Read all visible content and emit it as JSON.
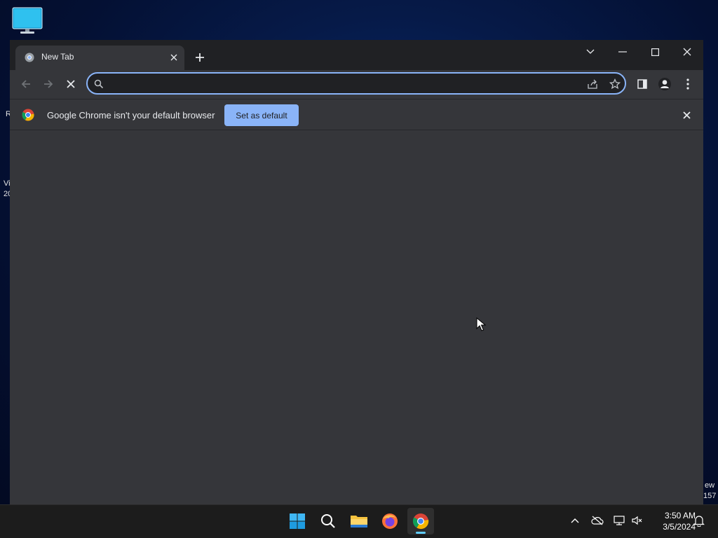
{
  "desktop": {
    "icon": "monitor-icon",
    "edge_text_left": [
      "R",
      "Vi",
      "20"
    ],
    "edge_text_right": [
      "ew",
      "157"
    ]
  },
  "browser": {
    "tab": {
      "title": "New Tab",
      "favicon": "chrome-favicon-icon",
      "close_icon": "close-icon"
    },
    "new_tab_icon": "plus-icon",
    "window_controls": [
      "chevron-down-icon",
      "minimize-icon",
      "maximize-icon",
      "close-icon"
    ],
    "toolbar": {
      "back_icon": "back-arrow-icon",
      "forward_icon": "forward-arrow-icon",
      "stop_icon": "stop-icon",
      "omnibox_value": "",
      "omnibox_placeholder": "",
      "share_icon": "share-icon",
      "bookmark_icon": "star-icon",
      "side_panel_icon": "side-panel-icon",
      "profile_icon": "profile-icon",
      "menu_icon": "kebab-menu-icon"
    },
    "infobar": {
      "message": "Google Chrome isn't your default browser",
      "button_label": "Set as default"
    }
  },
  "taskbar": {
    "apps": [
      "windows-start-icon",
      "search-icon",
      "file-explorer-icon",
      "firefox-icon",
      "chrome-icon"
    ],
    "tray": [
      "chevron-up-icon",
      "onedrive-offline-icon",
      "network-icon",
      "speaker-muted-icon",
      "notification-icon"
    ],
    "time": "3:50 AM",
    "date": "3/5/2024"
  },
  "colors": {
    "accent": "#8ab4f8",
    "window_bg": "#35363a",
    "titlebar_bg": "#202124",
    "taskbar_bg": "#1c1c1c",
    "active_indicator": "#60cdff"
  }
}
